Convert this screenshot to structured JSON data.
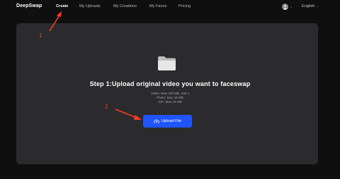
{
  "header": {
    "logo": "DeepSwap",
    "nav": [
      {
        "label": "Create",
        "active": true
      },
      {
        "label": "My Uploads",
        "active": false
      },
      {
        "label": "My Creations",
        "active": false
      },
      {
        "label": "My Faces",
        "active": false
      },
      {
        "label": "Pricing",
        "active": false
      }
    ],
    "language": "English",
    "icons": {
      "avatar": "user-avatar-icon",
      "caret": "chevron-down-icon"
    }
  },
  "upload": {
    "icon": "folder-icon",
    "headline": "Step 1:Upload original video you want to faceswap",
    "limits": [
      "Video: Max 100 MB, 100 s",
      "Photo: Max 10 MB",
      "GIF: Max 15 MB"
    ],
    "button_label": "Upload File",
    "button_icon": "cloud-upload-icon"
  },
  "annotations": [
    "1",
    "2"
  ],
  "colors": {
    "background": "#0f0f10",
    "panel": "#2b2b2d",
    "accent": "#1f55ff",
    "annotation": "#ff3b1f"
  }
}
